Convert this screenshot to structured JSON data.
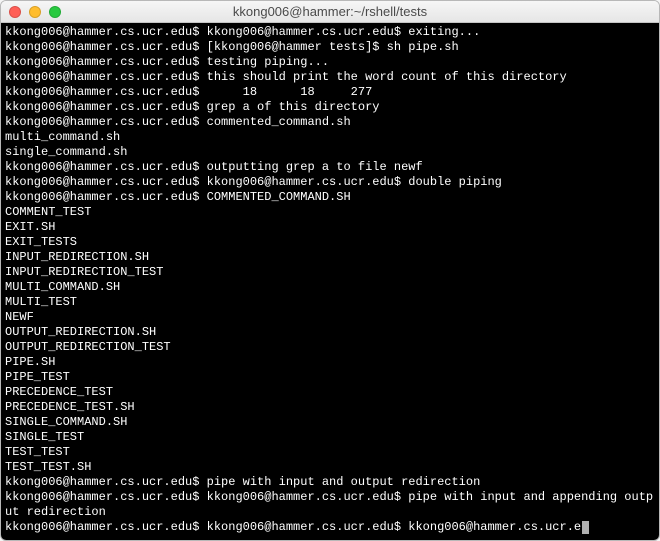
{
  "window": {
    "title": "kkong006@hammer:~/rshell/tests"
  },
  "prompt": "kkong006@hammer.cs.ucr.edu$",
  "prompt_alt": "[kkong006@hammer tests]$",
  "lines": [
    {
      "type": "cmd",
      "prompt": "kkong006@hammer.cs.ucr.edu$",
      "rest": " kkong006@hammer.cs.ucr.edu$ exiting..."
    },
    {
      "type": "cmd",
      "prompt": "kkong006@hammer.cs.ucr.edu$",
      "rest": " [kkong006@hammer tests]$ sh pipe.sh"
    },
    {
      "type": "cmd",
      "prompt": "kkong006@hammer.cs.ucr.edu$",
      "rest": " testing piping..."
    },
    {
      "type": "cmd",
      "prompt": "kkong006@hammer.cs.ucr.edu$",
      "rest": " this should print the word count of this directory"
    },
    {
      "type": "cmd",
      "prompt": "kkong006@hammer.cs.ucr.edu$",
      "rest": "      18      18     277"
    },
    {
      "type": "cmd",
      "prompt": "kkong006@hammer.cs.ucr.edu$",
      "rest": " grep a of this directory"
    },
    {
      "type": "cmd",
      "prompt": "kkong006@hammer.cs.ucr.edu$",
      "rest": " commented_command.sh"
    },
    {
      "type": "out",
      "text": "multi_command.sh"
    },
    {
      "type": "out",
      "text": "single_command.sh"
    },
    {
      "type": "cmd",
      "prompt": "kkong006@hammer.cs.ucr.edu$",
      "rest": " outputting grep a to file newf"
    },
    {
      "type": "cmd",
      "prompt": "kkong006@hammer.cs.ucr.edu$",
      "rest": " kkong006@hammer.cs.ucr.edu$ double piping"
    },
    {
      "type": "cmd",
      "prompt": "kkong006@hammer.cs.ucr.edu$",
      "rest": " COMMENTED_COMMAND.SH"
    },
    {
      "type": "out",
      "text": "COMMENT_TEST"
    },
    {
      "type": "out",
      "text": "EXIT.SH"
    },
    {
      "type": "out",
      "text": "EXIT_TESTS"
    },
    {
      "type": "out",
      "text": "INPUT_REDIRECTION.SH"
    },
    {
      "type": "out",
      "text": "INPUT_REDIRECTION_TEST"
    },
    {
      "type": "out",
      "text": "MULTI_COMMAND.SH"
    },
    {
      "type": "out",
      "text": "MULTI_TEST"
    },
    {
      "type": "out",
      "text": "NEWF"
    },
    {
      "type": "out",
      "text": "OUTPUT_REDIRECTION.SH"
    },
    {
      "type": "out",
      "text": "OUTPUT_REDIRECTION_TEST"
    },
    {
      "type": "out",
      "text": "PIPE.SH"
    },
    {
      "type": "out",
      "text": "PIPE_TEST"
    },
    {
      "type": "out",
      "text": "PRECEDENCE_TEST"
    },
    {
      "type": "out",
      "text": "PRECEDENCE_TEST.SH"
    },
    {
      "type": "out",
      "text": "SINGLE_COMMAND.SH"
    },
    {
      "type": "out",
      "text": "SINGLE_TEST"
    },
    {
      "type": "out",
      "text": "TEST_TEST"
    },
    {
      "type": "out",
      "text": "TEST_TEST.SH"
    },
    {
      "type": "cmd",
      "prompt": "kkong006@hammer.cs.ucr.edu$",
      "rest": " pipe with input and output redirection"
    },
    {
      "type": "cmd",
      "prompt": "kkong006@hammer.cs.ucr.edu$",
      "rest": " kkong006@hammer.cs.ucr.edu$ pipe with input and appending output redirection"
    },
    {
      "type": "cmd",
      "prompt": "kkong006@hammer.cs.ucr.edu$",
      "rest": " kkong006@hammer.cs.ucr.edu$ kkong006@hammer.cs.ucr.e",
      "cursor": true
    }
  ]
}
